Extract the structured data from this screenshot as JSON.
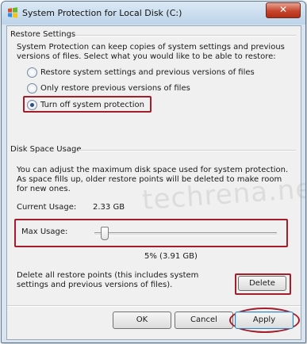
{
  "window": {
    "title": "System Protection for Local Disk (C:)",
    "close_glyph": "✕"
  },
  "restore_settings": {
    "group_title": "Restore Settings",
    "description": "System Protection can keep copies of system settings and previous versions of files. Select what you would like to be able to restore:",
    "options": [
      {
        "label": "Restore system settings and previous versions of files",
        "selected": false
      },
      {
        "label": "Only restore previous versions of files",
        "selected": false
      },
      {
        "label": "Turn off system protection",
        "selected": true
      }
    ]
  },
  "disk_space": {
    "group_title": "Disk Space Usage",
    "description": "You can adjust the maximum disk space used for system protection. As space fills up, older restore points will be deleted to make room for new ones.",
    "current_usage_label": "Current Usage:",
    "current_usage_value": "2.33 GB",
    "max_usage_label": "Max Usage:",
    "max_usage_percent": 5,
    "max_usage_value": "5% (3.91 GB)",
    "delete_description": "Delete all restore points (this includes system settings and previous versions of files).",
    "delete_label": "Delete"
  },
  "buttons": {
    "ok": "OK",
    "cancel": "Cancel",
    "apply": "Apply"
  },
  "watermark": "techrena.net",
  "colors": {
    "highlight": "#a51d2a",
    "title_gradient_top": "#dce9f5",
    "dialog_bg": "#f0f0f0"
  }
}
